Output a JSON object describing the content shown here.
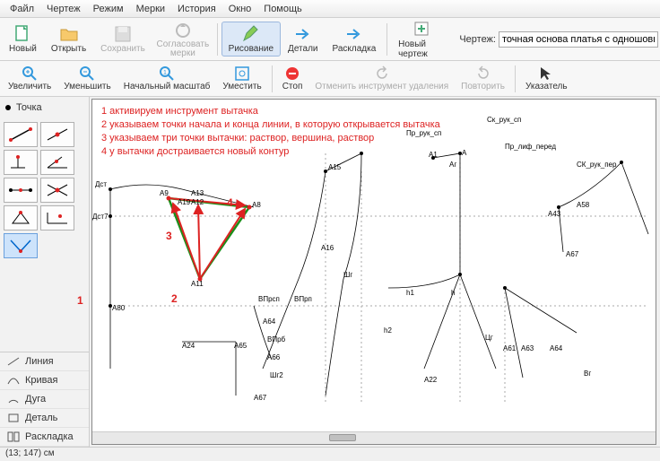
{
  "menu": {
    "items": [
      "Файл",
      "Чертеж",
      "Режим",
      "Мерки",
      "История",
      "Окно",
      "Помощь"
    ]
  },
  "toolbar1": {
    "new": "Новый",
    "open": "Открыть",
    "save": "Сохранить",
    "agree": "Согласовать мерки",
    "draw": "Рисование",
    "details": "Детали",
    "layout": "Раскладка",
    "newdrawing": "Новый чертеж",
    "drawinglabel": "Чертеж:",
    "drawingname": "точная основа платья с одношовным рука"
  },
  "toolbar2": {
    "zoomin": "Увеличить",
    "zoomout": "Уменьшить",
    "zoomreset": "Начальный масштаб",
    "fit": "Уместить",
    "stop": "Стоп",
    "undo": "Отменить инструмент удаления",
    "redo": "Повторить",
    "pointer": "Указатель"
  },
  "sidebar": {
    "top": "Точка",
    "categories": [
      "Линия",
      "Кривая",
      "Дуга",
      "Деталь",
      "Раскладка"
    ]
  },
  "instructions": [
    "1 активируем инструмент вытачка",
    "2 указываем точки начала и конца линии, в которую открывается вытачка",
    "3 указываем три точки вытачки: раствор, вершина, раствор",
    "4 у вытачки достраивается новый контур"
  ],
  "callouts": {
    "n1": "1",
    "n2": "2",
    "n3": "3",
    "n4": "4"
  },
  "points": {
    "Dst": "Дст",
    "Dst7": "Дст7",
    "A80": "А80",
    "A24": "А24",
    "A65": "А65",
    "A9": "А9",
    "A12": "А12",
    "A13": "А13",
    "A19": "А19",
    "A11": "А11",
    "A8": "А8",
    "A15": "А15",
    "A16": "А16",
    "Vprsp": "ВПрсп",
    "Vprp": "ВПрп",
    "A64": "А64",
    "Vprb": "ВПрб",
    "A66": "А66",
    "Shg": "Шг",
    "Shg2": "Шг2",
    "A67": "А67",
    "A": "А",
    "A1": "А1",
    "Ag": "Аг",
    "h1": "h1",
    "h": "h",
    "h2": "h2",
    "A22": "А22",
    "Cg": "Цг",
    "A61": "А61",
    "A63": "А63",
    "A64r": "А64",
    "Bg": "Вг",
    "A43": "А43",
    "A58": "А58",
    "A67r": "А67",
    "lab1": "Ск_рук_сп",
    "lab2": "Пр_рук_сп",
    "lab3": "Пр_лиф_перед",
    "lab4": "СК_рук_пер"
  },
  "status": "(13; 147) см"
}
